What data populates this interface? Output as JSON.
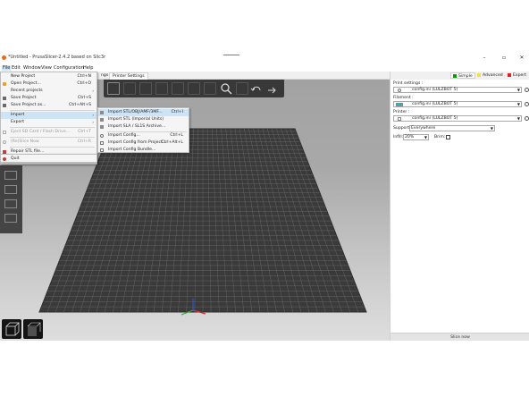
{
  "window": {
    "title": "*Untitled - PrusaSlicer-2.4.2 based on Slic3r",
    "controls": [
      "–",
      "▫",
      "✕"
    ]
  },
  "menubar": [
    "File",
    "Edit",
    "Window",
    "View",
    "Configuration",
    "Help"
  ],
  "tabs": [
    "ngs",
    "Printer Settings"
  ],
  "file_menu": [
    {
      "label": "New Project",
      "shortcut": "Ctrl+N",
      "icon": "new-project-icon"
    },
    {
      "label": "Open Project...",
      "shortcut": "Ctrl+O",
      "icon": "open-project-icon"
    },
    {
      "label": "Recent projects",
      "shortcut": "",
      "submenu": true
    },
    {
      "label": "Save Project",
      "shortcut": "Ctrl+S",
      "icon": "save-icon"
    },
    {
      "label": "Save Project as...",
      "shortcut": "Ctrl+Alt+S",
      "icon": "save-as-icon"
    },
    {
      "label": "Import",
      "shortcut": "",
      "submenu": true,
      "highlighted": true
    },
    {
      "label": "Export",
      "shortcut": "",
      "submenu": true
    },
    {
      "label": "Eject SD Card / Flash Drive...",
      "shortcut": "Ctrl+T",
      "disabled": true,
      "icon": "eject-icon"
    },
    {
      "label": "(Re)Slice Now",
      "shortcut": "Ctrl+R",
      "disabled": true,
      "icon": "reslice-icon"
    },
    {
      "label": "Repair STL file...",
      "shortcut": "",
      "icon": "repair-icon"
    },
    {
      "label": "G-code Preview...",
      "shortcut": ""
    },
    {
      "label": "Quit",
      "shortcut": "",
      "icon": "quit-icon"
    }
  ],
  "import_menu": [
    {
      "label": "Import STL/OBJ/AMF/3MF...",
      "shortcut": "Ctrl+I",
      "highlighted": true
    },
    {
      "label": "Import STL (Imperial Units)",
      "shortcut": ""
    },
    {
      "label": "Import SLA / SL1S Archive...",
      "shortcut": ""
    },
    {
      "label": "Import Config...",
      "shortcut": "Ctrl+L"
    },
    {
      "label": "Import Config from Project...",
      "shortcut": "Ctrl+Alt+L"
    },
    {
      "label": "Import Config Bundle...",
      "shortcut": ""
    }
  ],
  "sidebar": {
    "modes": [
      {
        "label": "Simple",
        "color": "#00a000"
      },
      {
        "label": "Advanced",
        "color": "#f0e040"
      },
      {
        "label": "Expert",
        "color": "#e02020"
      }
    ],
    "print_settings_label": "Print settings :",
    "print_settings_value": "config.ini (LULZBOT 5)",
    "filament_label": "Filament :",
    "filament_value": "config.ini (LULZBOT 5)",
    "filament_color": "#29b5c4",
    "printer_label": "Printer :",
    "printer_value": "config.ini (LULZBOT 5)",
    "supports_label": "Supports:",
    "supports_value": "Everywhere",
    "infill_label": "Infill:",
    "infill_value": "20%",
    "brim_label": "Brim:",
    "slice_button": "Slice now"
  }
}
